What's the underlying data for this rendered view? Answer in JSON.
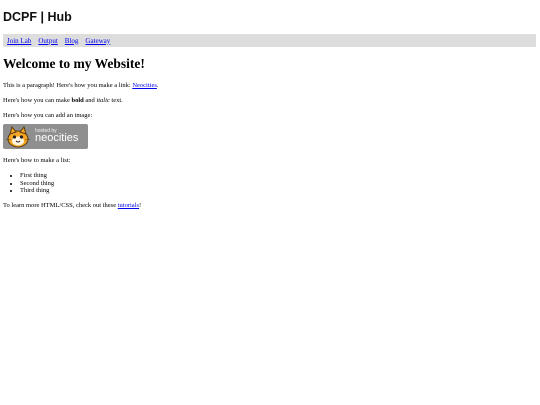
{
  "header": {
    "logo_text": "DCPF | Hub"
  },
  "nav": {
    "items": [
      {
        "label": "Join Lab"
      },
      {
        "label": "Output"
      },
      {
        "label": "Blog"
      },
      {
        "label": "Gateway"
      }
    ]
  },
  "main": {
    "heading": "Welcome to my Website!",
    "p1_prefix": "This is a paragraph! Here's how you make a link: ",
    "p1_link": "Neocities",
    "p1_suffix": ".",
    "p2_prefix": "Here's how you can make ",
    "p2_bold": "bold",
    "p2_mid": " and ",
    "p2_italic": "italic",
    "p2_suffix": " text.",
    "p3": "Here's how you can add an image:",
    "badge": {
      "small_text": "hosted by",
      "big_text": "neocities",
      "icon": "neocities-cat-icon"
    },
    "p4": "Here's how to make a list:",
    "list": [
      "First thing",
      "Second thing",
      "Third thing"
    ],
    "p5_prefix": "To learn more HTML/CSS, check out these ",
    "p5_link": "tutorials",
    "p5_suffix": "!"
  },
  "colors": {
    "link": "#0000ee",
    "nav_background": "#dddddd",
    "badge_background": "#8f8f8f"
  }
}
